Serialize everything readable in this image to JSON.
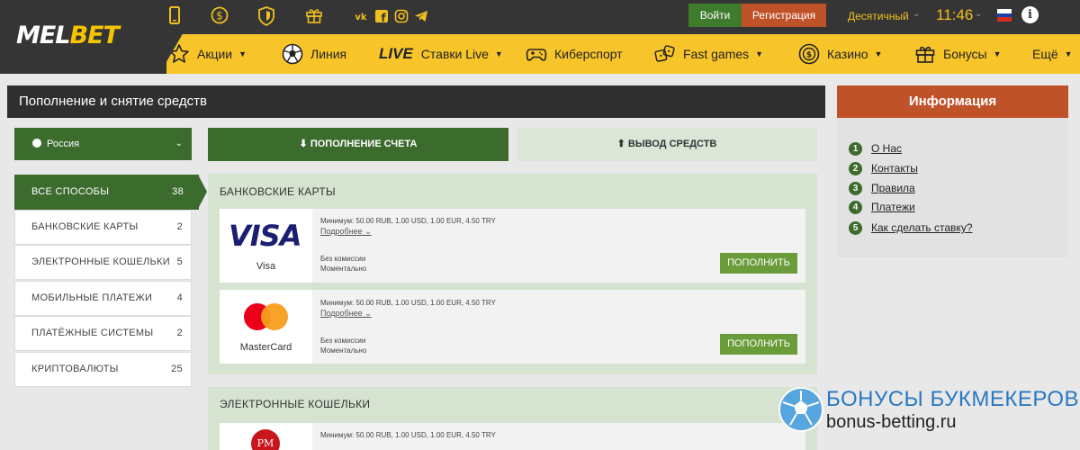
{
  "brand": {
    "logo_main": "MEL",
    "logo_accent": "BET"
  },
  "topbar": {
    "icons": [
      "mobile-icon",
      "dollar-icon",
      "shield-icon",
      "gift-icon"
    ],
    "socials": [
      "vk-icon",
      "facebook-icon",
      "instagram-icon",
      "telegram-icon"
    ],
    "login_label": "Войти",
    "register_label": "Регистрация",
    "odds_format": "Десятичный",
    "time": "11:46",
    "language_flag": "ru-flag"
  },
  "nav": {
    "items": [
      {
        "label": "Акции",
        "icon": "star-icon",
        "dropdown": true
      },
      {
        "label": "Линия",
        "icon": "football-icon",
        "dropdown": false
      },
      {
        "prefix": "LIVE",
        "label": "Ставки Live",
        "dropdown": true
      },
      {
        "label": "Киберспорт",
        "icon": "gamepad-icon",
        "dropdown": false
      },
      {
        "label": "Fast games",
        "icon": "dice-icon",
        "dropdown": true
      },
      {
        "label": "Казино",
        "icon": "casino-chip-icon",
        "dropdown": true
      },
      {
        "label": "Бонусы",
        "icon": "gift-icon",
        "dropdown": true
      },
      {
        "label": "Ещё",
        "dropdown": true
      }
    ]
  },
  "page": {
    "title": "Пополнение и снятие средств",
    "country": "Россия",
    "tab_deposit": "ПОПОЛНЕНИЕ СЧЕТА",
    "tab_withdraw": "ВЫВОД СРЕДСТВ"
  },
  "methods": [
    {
      "label": "ВСЕ СПОСОБЫ",
      "count": "38"
    },
    {
      "label": "БАНКОВСКИЕ КАРТЫ",
      "count": "2"
    },
    {
      "label": "ЭЛЕКТРОННЫЕ КОШЕЛЬКИ",
      "count": "5"
    },
    {
      "label": "МОБИЛЬНЫЕ ПЛАТЕЖИ",
      "count": "4"
    },
    {
      "label": "ПЛАТЁЖНЫЕ СИСТЕМЫ",
      "count": "2"
    },
    {
      "label": "КРИПТОВАЛЮТЫ",
      "count": "25"
    }
  ],
  "groups": {
    "bank_title": "БАНКОВСКИЕ КАРТЫ",
    "wallet_title": "ЭЛЕКТРОННЫЕ КОШЕЛЬКИ",
    "cards": [
      {
        "name": "Visa",
        "logo_text": "VISA",
        "min": "Минимум: 50.00 RUB, 1.00 USD, 1.00 EUR, 4.50 TRY",
        "more": "Подробнее",
        "fee": "Без комиссии",
        "time": "Моментально",
        "button": "ПОПОЛНИТЬ"
      },
      {
        "name": "MasterCard",
        "min": "Минимум: 50.00 RUB, 1.00 USD, 1.00 EUR, 4.50 TRY",
        "more": "Подробнее",
        "fee": "Без комиссии",
        "time": "Моментально",
        "button": "ПОПОЛНИТЬ"
      },
      {
        "logo_text": "PM",
        "min": "Минимум: 50.00 RUB, 1.00 USD, 1.00 EUR, 4.50 TRY"
      }
    ]
  },
  "info": {
    "title": "Информация",
    "links": [
      {
        "num": "1",
        "label": "О Нас"
      },
      {
        "num": "2",
        "label": "Контакты"
      },
      {
        "num": "3",
        "label": "Правила"
      },
      {
        "num": "4",
        "label": "Платежи"
      },
      {
        "num": "5",
        "label": "Как сделать ставку?"
      }
    ]
  },
  "watermark": {
    "title": "БОНУСЫ БУКМЕКЕРОВ",
    "url": "bonus-betting.ru"
  },
  "colors": {
    "brand_green": "#3b6b2d",
    "accent_yellow": "#f7c52a",
    "accent_orange": "#c0522a",
    "dark": "#353535"
  }
}
